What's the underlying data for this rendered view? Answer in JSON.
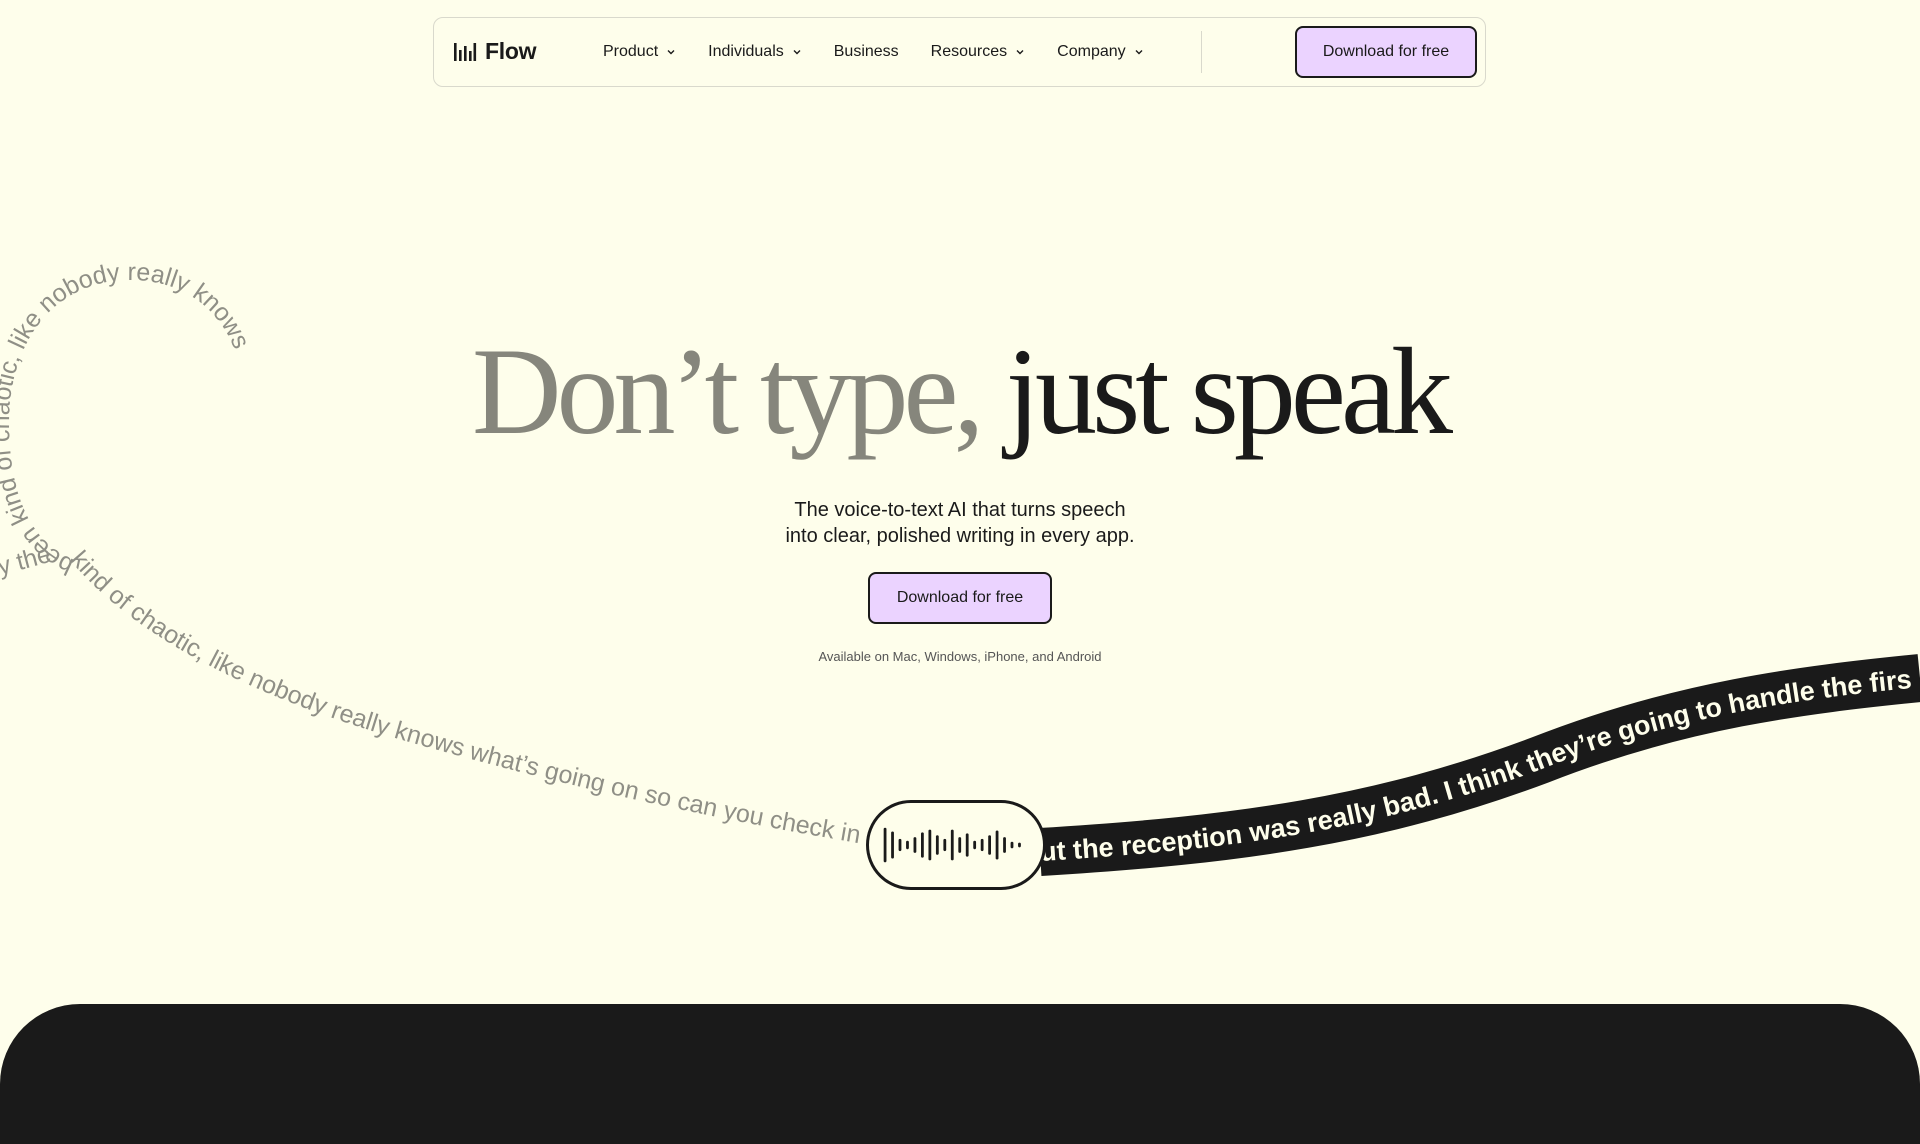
{
  "brand": {
    "name": "Flow",
    "icon": "waveform-logo-icon"
  },
  "nav": {
    "items": [
      {
        "label": "Product",
        "has_dropdown": true
      },
      {
        "label": "Individuals",
        "has_dropdown": true
      },
      {
        "label": "Business",
        "has_dropdown": false
      },
      {
        "label": "Resources",
        "has_dropdown": true
      },
      {
        "label": "Company",
        "has_dropdown": true
      }
    ],
    "cta_label": "Download for free"
  },
  "hero": {
    "title_part1": "Don’t type,",
    "title_part2": "just speak",
    "subtitle_line1": "The voice-to-text AI that turns speech",
    "subtitle_line2": "into clear, polished writing in every app.",
    "cta_label": "Download for free",
    "platforms": "Available on Mac, Windows, iPhone, and Android"
  },
  "transcript": {
    "loop_text": "kind of chaotic, like nobody really knows what’s going on so can you check in with them and see if the notes fro",
    "loop_top_text": "been kind of chaotic, like nobody really knows",
    "tail_text": "y the the whole thing’s been",
    "band_text": "ut the reception was really bad. I think they’re going to handle the firs"
  },
  "colors": {
    "background": "#FEFEEB",
    "accent": "#EBD3FF",
    "dark": "#1a1a1a",
    "muted_text": "#86867c"
  }
}
